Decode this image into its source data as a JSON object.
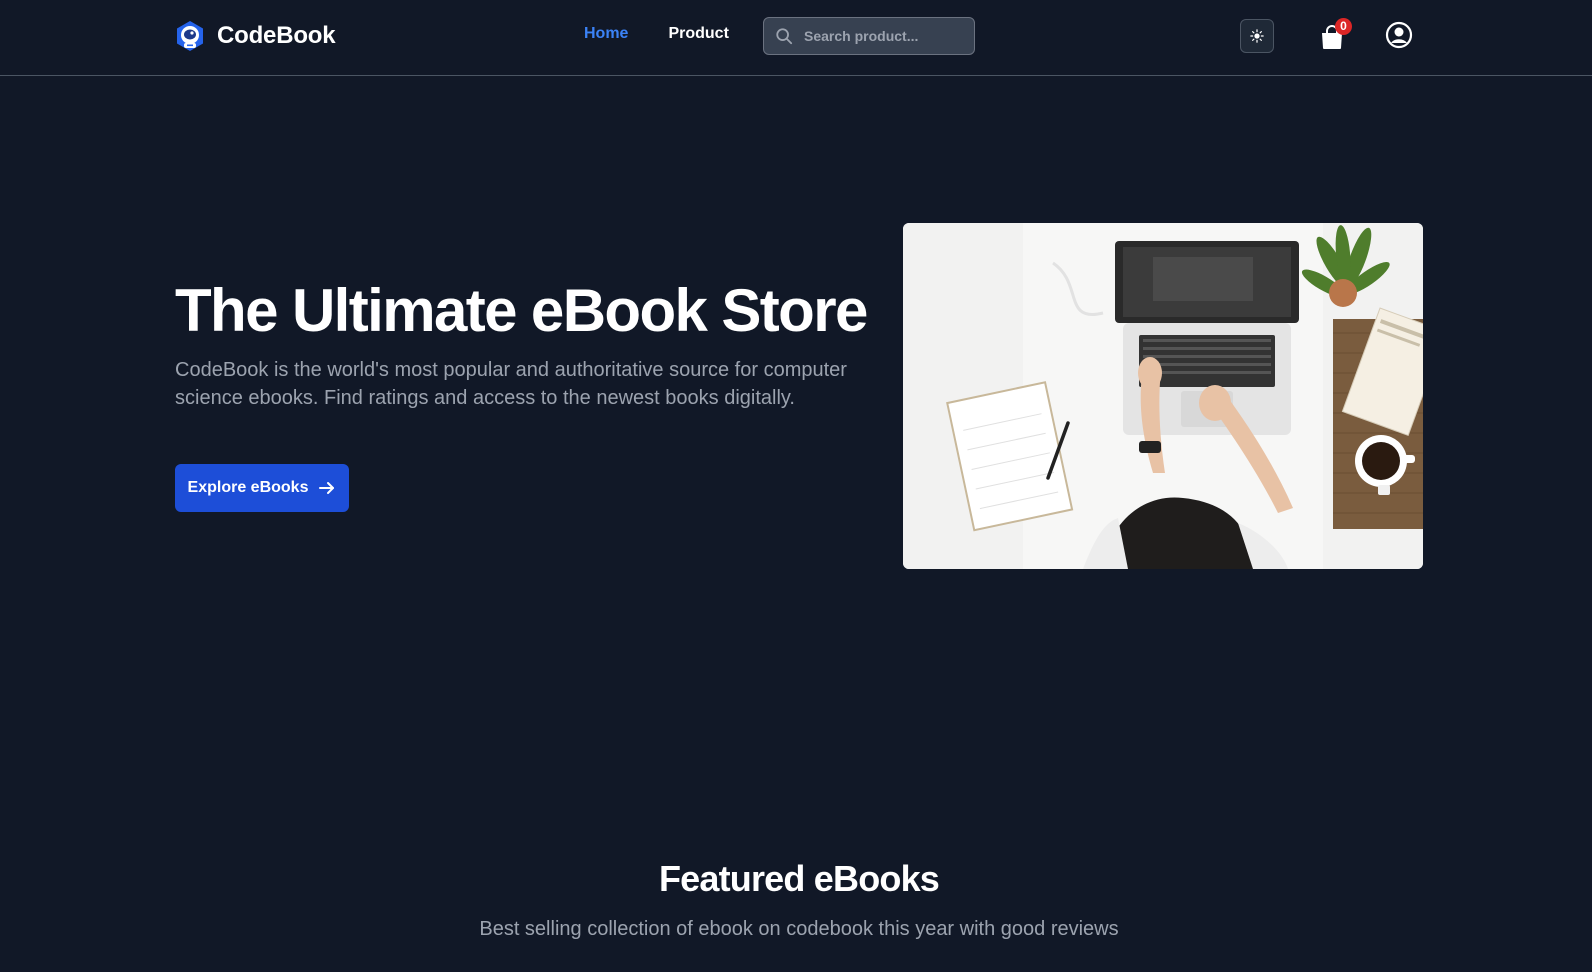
{
  "header": {
    "brand_name": "CodeBook",
    "brand_logo": "astronaut-helmet-icon",
    "nav": [
      {
        "label": "Home",
        "active": true
      },
      {
        "label": "Product",
        "active": false
      }
    ],
    "search": {
      "placeholder": "Search product...",
      "icon": "search-icon"
    },
    "theme_toggle_icon": "sun-icon",
    "cart": {
      "icon": "shopping-bag-icon",
      "count": "0"
    },
    "account_icon": "user-circle-icon"
  },
  "hero": {
    "title": "The Ultimate eBook Store",
    "description": "CodeBook is the world's most popular and authoritative source for computer science ebooks. Find ratings and access to the newest books digitally.",
    "cta_label": "Explore eBooks",
    "cta_icon": "arrow-right-icon"
  },
  "featured": {
    "title": "Featured eBooks",
    "subtitle": "Best selling collection of ebook on codebook this year with good reviews"
  },
  "colors": {
    "background": "#111827",
    "accent": "#3b82f6",
    "button": "#1d4ed8",
    "badge": "#dc2626",
    "muted_text": "#9ca3af"
  }
}
